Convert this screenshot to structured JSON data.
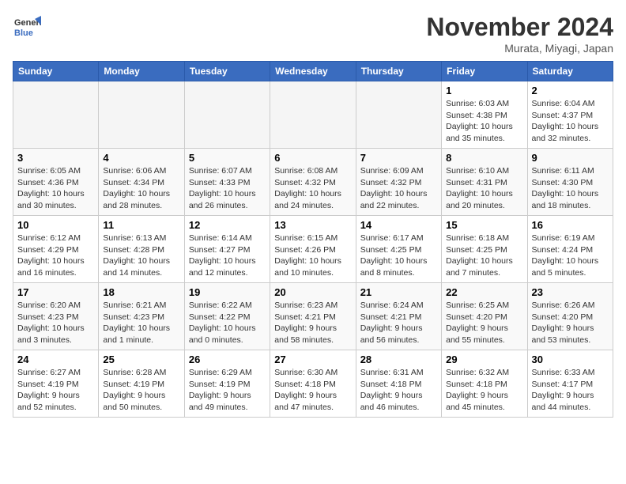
{
  "header": {
    "logo_line1": "General",
    "logo_line2": "Blue",
    "month": "November 2024",
    "location": "Murata, Miyagi, Japan"
  },
  "days_of_week": [
    "Sunday",
    "Monday",
    "Tuesday",
    "Wednesday",
    "Thursday",
    "Friday",
    "Saturday"
  ],
  "weeks": [
    [
      {
        "num": "",
        "info": ""
      },
      {
        "num": "",
        "info": ""
      },
      {
        "num": "",
        "info": ""
      },
      {
        "num": "",
        "info": ""
      },
      {
        "num": "",
        "info": ""
      },
      {
        "num": "1",
        "info": "Sunrise: 6:03 AM\nSunset: 4:38 PM\nDaylight: 10 hours\nand 35 minutes."
      },
      {
        "num": "2",
        "info": "Sunrise: 6:04 AM\nSunset: 4:37 PM\nDaylight: 10 hours\nand 32 minutes."
      }
    ],
    [
      {
        "num": "3",
        "info": "Sunrise: 6:05 AM\nSunset: 4:36 PM\nDaylight: 10 hours\nand 30 minutes."
      },
      {
        "num": "4",
        "info": "Sunrise: 6:06 AM\nSunset: 4:34 PM\nDaylight: 10 hours\nand 28 minutes."
      },
      {
        "num": "5",
        "info": "Sunrise: 6:07 AM\nSunset: 4:33 PM\nDaylight: 10 hours\nand 26 minutes."
      },
      {
        "num": "6",
        "info": "Sunrise: 6:08 AM\nSunset: 4:32 PM\nDaylight: 10 hours\nand 24 minutes."
      },
      {
        "num": "7",
        "info": "Sunrise: 6:09 AM\nSunset: 4:32 PM\nDaylight: 10 hours\nand 22 minutes."
      },
      {
        "num": "8",
        "info": "Sunrise: 6:10 AM\nSunset: 4:31 PM\nDaylight: 10 hours\nand 20 minutes."
      },
      {
        "num": "9",
        "info": "Sunrise: 6:11 AM\nSunset: 4:30 PM\nDaylight: 10 hours\nand 18 minutes."
      }
    ],
    [
      {
        "num": "10",
        "info": "Sunrise: 6:12 AM\nSunset: 4:29 PM\nDaylight: 10 hours\nand 16 minutes."
      },
      {
        "num": "11",
        "info": "Sunrise: 6:13 AM\nSunset: 4:28 PM\nDaylight: 10 hours\nand 14 minutes."
      },
      {
        "num": "12",
        "info": "Sunrise: 6:14 AM\nSunset: 4:27 PM\nDaylight: 10 hours\nand 12 minutes."
      },
      {
        "num": "13",
        "info": "Sunrise: 6:15 AM\nSunset: 4:26 PM\nDaylight: 10 hours\nand 10 minutes."
      },
      {
        "num": "14",
        "info": "Sunrise: 6:17 AM\nSunset: 4:25 PM\nDaylight: 10 hours\nand 8 minutes."
      },
      {
        "num": "15",
        "info": "Sunrise: 6:18 AM\nSunset: 4:25 PM\nDaylight: 10 hours\nand 7 minutes."
      },
      {
        "num": "16",
        "info": "Sunrise: 6:19 AM\nSunset: 4:24 PM\nDaylight: 10 hours\nand 5 minutes."
      }
    ],
    [
      {
        "num": "17",
        "info": "Sunrise: 6:20 AM\nSunset: 4:23 PM\nDaylight: 10 hours\nand 3 minutes."
      },
      {
        "num": "18",
        "info": "Sunrise: 6:21 AM\nSunset: 4:23 PM\nDaylight: 10 hours\nand 1 minute."
      },
      {
        "num": "19",
        "info": "Sunrise: 6:22 AM\nSunset: 4:22 PM\nDaylight: 10 hours\nand 0 minutes."
      },
      {
        "num": "20",
        "info": "Sunrise: 6:23 AM\nSunset: 4:21 PM\nDaylight: 9 hours\nand 58 minutes."
      },
      {
        "num": "21",
        "info": "Sunrise: 6:24 AM\nSunset: 4:21 PM\nDaylight: 9 hours\nand 56 minutes."
      },
      {
        "num": "22",
        "info": "Sunrise: 6:25 AM\nSunset: 4:20 PM\nDaylight: 9 hours\nand 55 minutes."
      },
      {
        "num": "23",
        "info": "Sunrise: 6:26 AM\nSunset: 4:20 PM\nDaylight: 9 hours\nand 53 minutes."
      }
    ],
    [
      {
        "num": "24",
        "info": "Sunrise: 6:27 AM\nSunset: 4:19 PM\nDaylight: 9 hours\nand 52 minutes."
      },
      {
        "num": "25",
        "info": "Sunrise: 6:28 AM\nSunset: 4:19 PM\nDaylight: 9 hours\nand 50 minutes."
      },
      {
        "num": "26",
        "info": "Sunrise: 6:29 AM\nSunset: 4:19 PM\nDaylight: 9 hours\nand 49 minutes."
      },
      {
        "num": "27",
        "info": "Sunrise: 6:30 AM\nSunset: 4:18 PM\nDaylight: 9 hours\nand 47 minutes."
      },
      {
        "num": "28",
        "info": "Sunrise: 6:31 AM\nSunset: 4:18 PM\nDaylight: 9 hours\nand 46 minutes."
      },
      {
        "num": "29",
        "info": "Sunrise: 6:32 AM\nSunset: 4:18 PM\nDaylight: 9 hours\nand 45 minutes."
      },
      {
        "num": "30",
        "info": "Sunrise: 6:33 AM\nSunset: 4:17 PM\nDaylight: 9 hours\nand 44 minutes."
      }
    ]
  ]
}
